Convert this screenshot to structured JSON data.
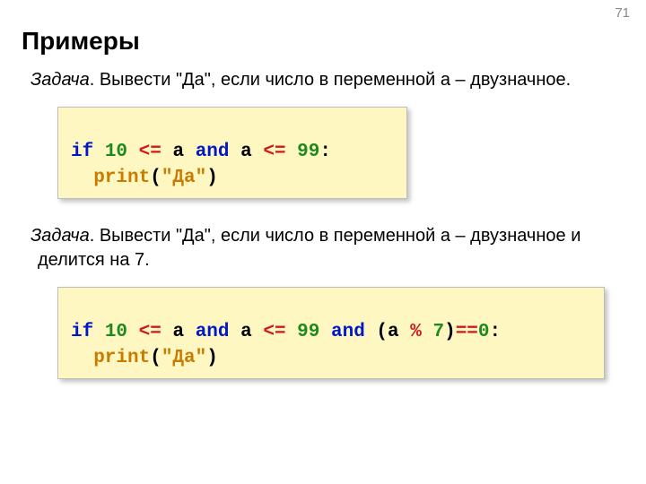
{
  "page_number": "71",
  "title": "Примеры",
  "task1": {
    "label": "Задача",
    "text": ". Вывести \"Да\", если число в переменной a – двузначное.",
    "code": {
      "t_if": "if",
      "t_10": "10",
      "t_le1": "<=",
      "t_a1": "a",
      "t_and1": "and",
      "t_a2": "a",
      "t_le2": "<=",
      "t_99": "99",
      "t_colon": ":",
      "t_print": "print",
      "t_lpar": "(",
      "t_str": "\"Да\"",
      "t_rpar": ")"
    }
  },
  "task2": {
    "label": "Задача",
    "text": ". Вывести \"Да\", если число в переменной a – двузначное и делится на 7.",
    "code": {
      "t_if": "if",
      "t_10": "10",
      "t_le1": "<=",
      "t_a1": "a",
      "t_and1": "and",
      "t_a2": "a",
      "t_le2": "<=",
      "t_99": "99",
      "t_and2": "and",
      "t_lpar1": "(",
      "t_a3": "a",
      "t_mod": "%",
      "t_7": "7",
      "t_rpar1": ")",
      "t_eq": "==",
      "t_0": "0",
      "t_colon": ":",
      "t_print": "print",
      "t_lpar2": "(",
      "t_str": "\"Да\"",
      "t_rpar2": ")"
    }
  }
}
